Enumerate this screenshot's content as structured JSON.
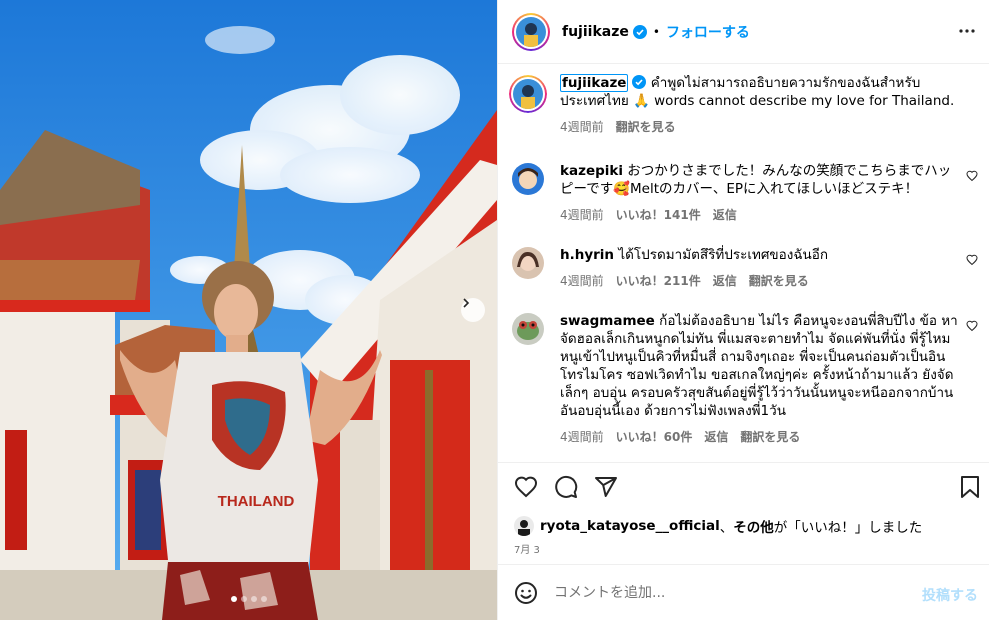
{
  "header": {
    "username": "fujiikaze",
    "separator": "•",
    "follow_label": "フォローする",
    "more_icon": "more-horizontal-icon"
  },
  "caption": {
    "username": "fujiikaze",
    "text": "คำพูดไม่สามารถอธิบายความรักของฉันสำหรับประเทศไทย 🙏   words cannot describe my love for Thailand.",
    "time": "4週間前",
    "translate": "翻訳を見る"
  },
  "comments": [
    {
      "username": "kazepiki",
      "text": "おつかりさまでした！みんなの笑顔でこちらまでハッピーです🥰Meltのカバー、EPに入れてほしいほどステキ！",
      "time": "4週間前",
      "likes": "いいね！141件",
      "reply": "返信",
      "translate": ""
    },
    {
      "username": "h.hyrin",
      "text": "ได้โปรดมามัตสึริที่ประเทศของฉันอีก",
      "time": "4週間前",
      "likes": "いいね！211件",
      "reply": "返信",
      "translate": "翻訳を見る"
    },
    {
      "username": "swagmamee",
      "text": "ก้อไม่ต้องอธิบาย ไม่ไร คือหนูจะงอนพี่สิบปีไง ข้อ หาจัดฮอลเล็กเกินหนูกดไม่ทัน พี่แมสจะตายทำไม จัดแค่พันที่นั่ง พี่รู้ไหมหนูเข้าไปหนูเป็นคิวที่หมื่นสี่ ถามจิงๆเถอะ พี่จะเป็นคนถ่อมตัวเป็นอินโทรไมโคร ซอฟเวิดทำไม ขอสเกลใหญ่ๆค่ะ ครั้งหน้าถ้ามาแล้ว ยังจัดเล็กๆ อบอุ่น ครอบครัวสุขสันต์อยู่พี่รู้ไว้ว่าวันนั้นหนูจะหนีออกจากบ้านอันอบอุ่นนี้เอง ด้วยการไม่ฟังเพลงพี่1วัน",
      "time": "4週間前",
      "likes": "いいね！60件",
      "reply": "返信",
      "translate": "翻訳を見る"
    }
  ],
  "actions": {
    "like_icon": "heart-icon",
    "comment_icon": "comment-icon",
    "share_icon": "send-icon",
    "save_icon": "bookmark-icon"
  },
  "likes_line": {
    "user": "ryota_katayose__official",
    "joiner": "、",
    "others": "その他",
    "suffix": "が「いいね！」しました"
  },
  "date": "7月 3",
  "add_comment": {
    "placeholder": "コメントを追加...",
    "post_label": "投稿する",
    "emoji_icon": "emoji-icon"
  },
  "carousel": {
    "slides": 4,
    "active_index": 0
  },
  "colors": {
    "accent": "#0095f6",
    "secondary_text": "#737373",
    "divider": "#efefef"
  }
}
